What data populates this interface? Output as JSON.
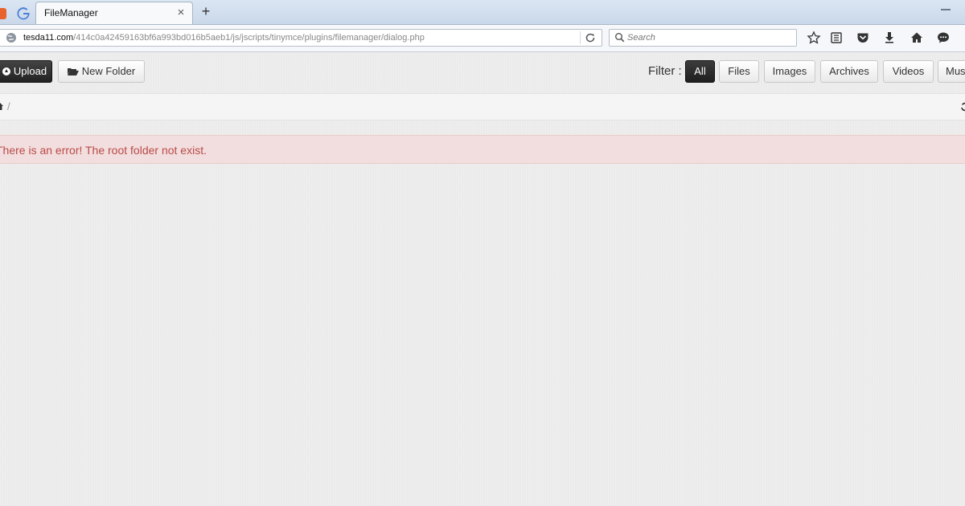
{
  "browser": {
    "tab": {
      "title": "FileManager",
      "close_glyph": "×"
    },
    "new_tab_glyph": "+",
    "url": {
      "host": "tesda11.com",
      "path": "/414c0a42459163bf6a993bd016b5aeb1/js/jscripts/tinymce/plugins/filemanager/dialog.php"
    },
    "search": {
      "placeholder": "Search"
    },
    "toolbar_icons": [
      "star-icon",
      "reading-list-icon",
      "pocket-icon",
      "download-icon",
      "home-icon",
      "chat-icon"
    ]
  },
  "filemanager": {
    "toolbar": {
      "upload_label": "Upload",
      "new_folder_label": "New Folder",
      "filter_label": "Filter :",
      "filters": [
        "All",
        "Files",
        "Images",
        "Archives",
        "Videos",
        "Music"
      ],
      "active_filter": "All"
    },
    "breadcrumb": {
      "separator": "/"
    },
    "error_message": "There is an error! The root folder not exist."
  },
  "colors": {
    "error_text": "#b94a48",
    "error_bg": "#f2dede",
    "active_button": "#222222"
  }
}
